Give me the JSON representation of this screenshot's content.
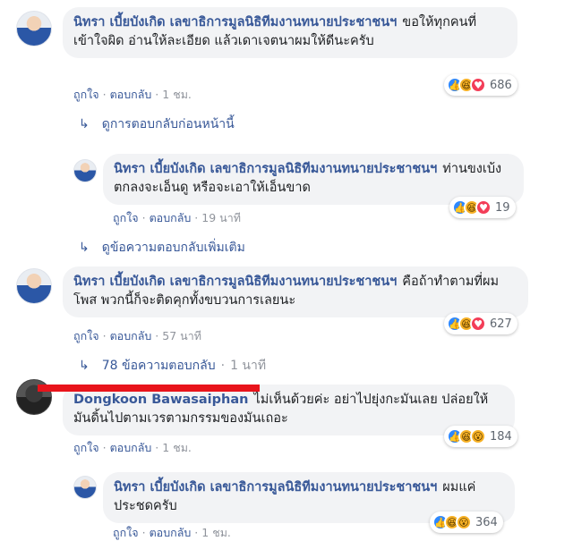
{
  "comments": [
    {
      "name": "นิทรา เบี้ยบังเกิด เลขาธิการมูลนิธิทีมงานทนายประชาชนฯ",
      "text": "ขอให้ทุกคนที่เข้าใจผิด อ่านให้ละเอียด แล้วเดาเจตนาผมให้ดีนะครับ",
      "like": "ถูกใจ",
      "reply": "ตอบกลับ",
      "time": "1 ชม.",
      "reactions": [
        "like-icon",
        "haha-icon",
        "love-icon"
      ],
      "count": "686"
    },
    {
      "view_prev": "ดูการตอบกลับก่อนหน้านี้"
    },
    {
      "name": "นิทรา เบี้ยบังเกิด เลขาธิการมูลนิธิทีมงานทนายประชาชนฯ",
      "text": "ท่านขงเบ้งตกลงจะเอ็นดู หรือจะเอาให้เอ็นขาด",
      "like": "ถูกใจ",
      "reply": "ตอบกลับ",
      "time": "19 นาที",
      "reactions": [
        "like-icon",
        "haha-icon",
        "love-icon"
      ],
      "count": "19"
    },
    {
      "view_more": "ดูข้อความตอบกลับเพิ่มเติม"
    },
    {
      "name": "นิทรา เบี้ยบังเกิด เลขาธิการมูลนิธิทีมงานทนายประชาชนฯ",
      "text": "คือถ้าทำตามที่ผมโพส พวกนี้ก็จะติดคุกทั้งขบวนการเลยนะ",
      "like": "ถูกใจ",
      "reply": "ตอบกลับ",
      "time": "57 นาที",
      "reactions": [
        "like-icon",
        "haha-icon",
        "love-icon"
      ],
      "count": "627",
      "replies_link": "78 ข้อความตอบกลับ",
      "replies_time": "1 นาที"
    },
    {
      "name": "Dongkoon Bawasaiphan",
      "text": "ไม่เห็นด้วยค่ะ อย่าไปยุ่งกะมันเลย ปล่อยให้มันดิ้นไปตามเวรตามกรรมของมันเถอะ",
      "like": "ถูกใจ",
      "reply": "ตอบกลับ",
      "time": "1 ชม.",
      "reactions": [
        "like-icon",
        "haha-icon",
        "wow-icon"
      ],
      "count": "184"
    },
    {
      "name": "นิทรา เบี้ยบังเกิด เลขาธิการมูลนิธิทีมงานทนายประชาชนฯ",
      "text": "ผมแค่ประชดครับ",
      "like": "ถูกใจ",
      "reply": "ตอบกลับ",
      "time": "1 ชม.",
      "reactions": [
        "like-icon",
        "haha-icon",
        "wow-icon"
      ],
      "count": "364"
    }
  ],
  "colors": {
    "name": "#385898",
    "bubble": "#f2f3f5",
    "redact": "#e8141b"
  }
}
